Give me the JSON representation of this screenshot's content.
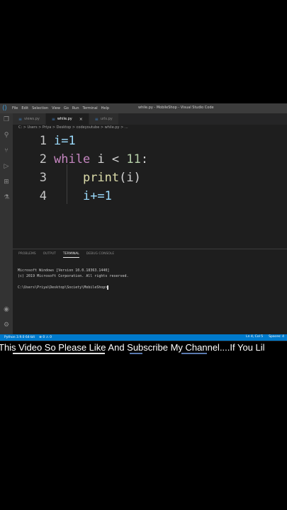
{
  "titlebar": {
    "menu": [
      "File",
      "Edit",
      "Selection",
      "View",
      "Go",
      "Run",
      "Terminal",
      "Help"
    ],
    "window_title": "while.py - MobileShop - Visual Studio Code"
  },
  "tabs": [
    {
      "label": "views.py",
      "active": false
    },
    {
      "label": "while.py",
      "active": true
    },
    {
      "label": "urls.py",
      "active": false
    }
  ],
  "breadcrumb": "C: > Users > Priya > Desktop > codeyoutube > while.py > ...",
  "code": [
    {
      "ln": "1",
      "text": "i=1"
    },
    {
      "ln": "2",
      "kw": "while",
      "rest": " i < ",
      "num": "11",
      "end": ":"
    },
    {
      "ln": "3",
      "fn": "print",
      "args": "(i)"
    },
    {
      "ln": "4",
      "text": "i+=1"
    }
  ],
  "panel": {
    "tabs": [
      "PROBLEMS",
      "OUTPUT",
      "TERMINAL",
      "DEBUG CONSOLE"
    ],
    "active_tab": "TERMINAL",
    "terminal_lines": [
      "Microsoft Windows [Version 10.0.18363.1440]",
      "(c) 2019 Microsoft Corporation. All rights reserved.",
      "",
      "C:\\Users\\Priya\\Desktop\\Society\\MobileShop>"
    ]
  },
  "statusbar": {
    "python": "Python 3.9.0 64-bit",
    "problems": "⊗ 0 ⚠ 0",
    "position": "Ln 4, Col 5",
    "spaces": "Spaces: 4"
  },
  "ticker": "This Video So Please Like And Subscribe My Channel....If You Lil",
  "colors": {
    "accent": "#007acc",
    "keyword": "#c586c0",
    "number": "#b5cea8",
    "function": "#dcdcaa"
  }
}
